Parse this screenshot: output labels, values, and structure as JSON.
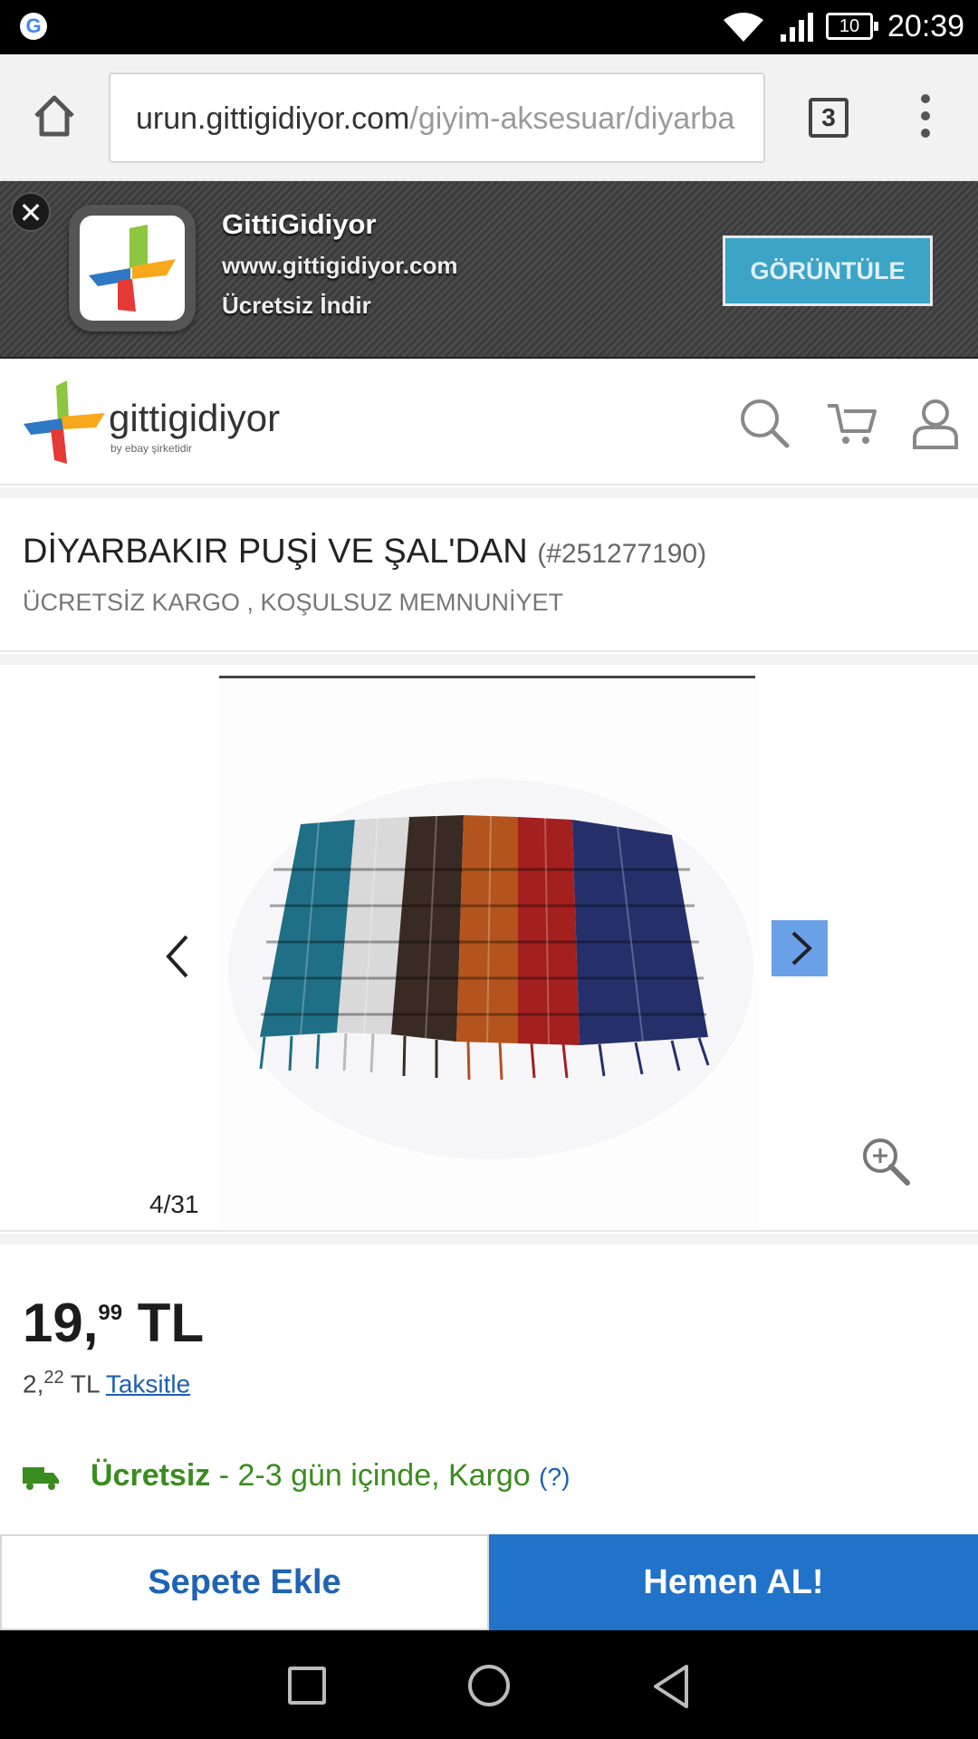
{
  "status_bar": {
    "time": "20:39",
    "battery": "10"
  },
  "browser": {
    "url_host": "urun.gittigidiyor.com",
    "url_path": "/giyim-aksesuar/diyarba",
    "tab_count": "3"
  },
  "app_banner": {
    "close": "✕",
    "app_name": "GittiGidiyor",
    "site": "www.gittigidiyor.com",
    "subtitle": "Ücretsiz İndir",
    "cta": "GÖRÜNTÜLE"
  },
  "site_header": {
    "logo_text": "gittigidiyor",
    "logo_sub": "by ebay şirketidir"
  },
  "product": {
    "title": "DİYARBAKIR PUŞİ VE ŞAL'DAN",
    "id": "(#251277190)",
    "subtitle": "ÜCRETSİZ KARGO , KOŞULSUZ MEMNUNİYET"
  },
  "gallery": {
    "counter": "4/31"
  },
  "price": {
    "main": "19,",
    "cents": "99",
    "currency": "TL",
    "installment_main": "2,",
    "installment_cents": "22",
    "installment_currency": "TL",
    "installment_link": "Taksitle"
  },
  "shipping": {
    "free": "Ücretsiz",
    "detail": "- 2-3 gün içinde, Kargo",
    "help": "(?)"
  },
  "actions": {
    "add_to_cart": "Sepete Ekle",
    "buy_now": "Hemen AL!"
  },
  "colors": {
    "accent_blue": "#2172c9",
    "shipping_green": "#3a8c1f",
    "banner_cta": "#3ba4c7"
  }
}
